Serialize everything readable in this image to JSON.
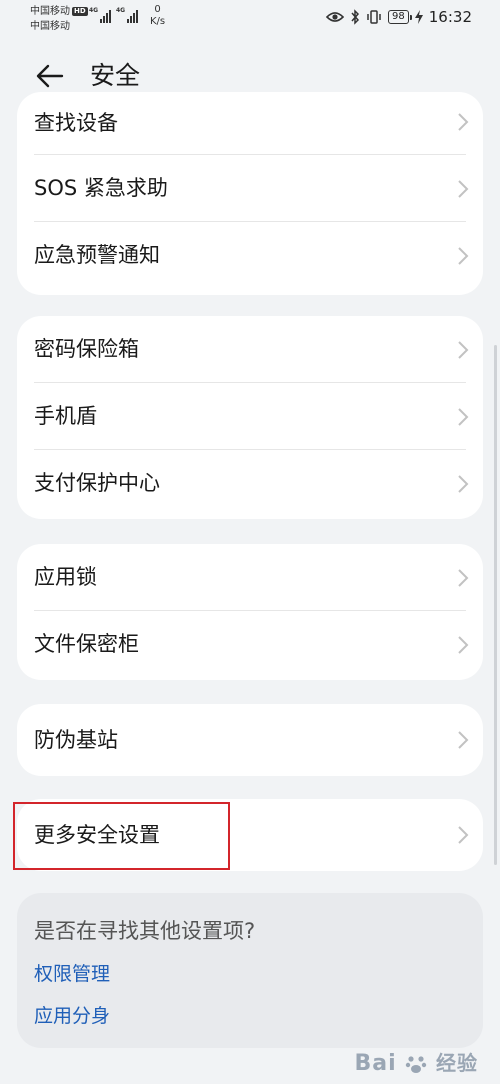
{
  "status_bar": {
    "carrier_1": "中国移动",
    "hd_badge": "HD",
    "carrier_2": "中国移动",
    "signal_1_tag": "4G",
    "signal_2_tag": "4G",
    "net_speed_value": "0",
    "net_speed_unit": "K/s",
    "battery": "98",
    "time": "16:32"
  },
  "header": {
    "title": "安全"
  },
  "groups": [
    {
      "items": [
        {
          "label": "查找设备"
        },
        {
          "label": "SOS 紧急求助"
        },
        {
          "label": "应急预警通知"
        }
      ]
    },
    {
      "items": [
        {
          "label": "密码保险箱"
        },
        {
          "label": "手机盾"
        },
        {
          "label": "支付保护中心"
        }
      ]
    },
    {
      "items": [
        {
          "label": "应用锁"
        },
        {
          "label": "文件保密柜"
        }
      ]
    },
    {
      "items": [
        {
          "label": "防伪基站"
        }
      ]
    },
    {
      "items": [
        {
          "label": "更多安全设置"
        }
      ]
    }
  ],
  "suggestions": {
    "title": "是否在寻找其他设置项?",
    "links": [
      {
        "label": "权限管理"
      },
      {
        "label": "应用分身"
      }
    ]
  },
  "watermark": {
    "text": "Bai",
    "suffix": "经验"
  },
  "colors": {
    "background": "#f1f3f5",
    "card": "#ffffff",
    "link": "#1f5fb8",
    "highlight": "#d3252b"
  }
}
